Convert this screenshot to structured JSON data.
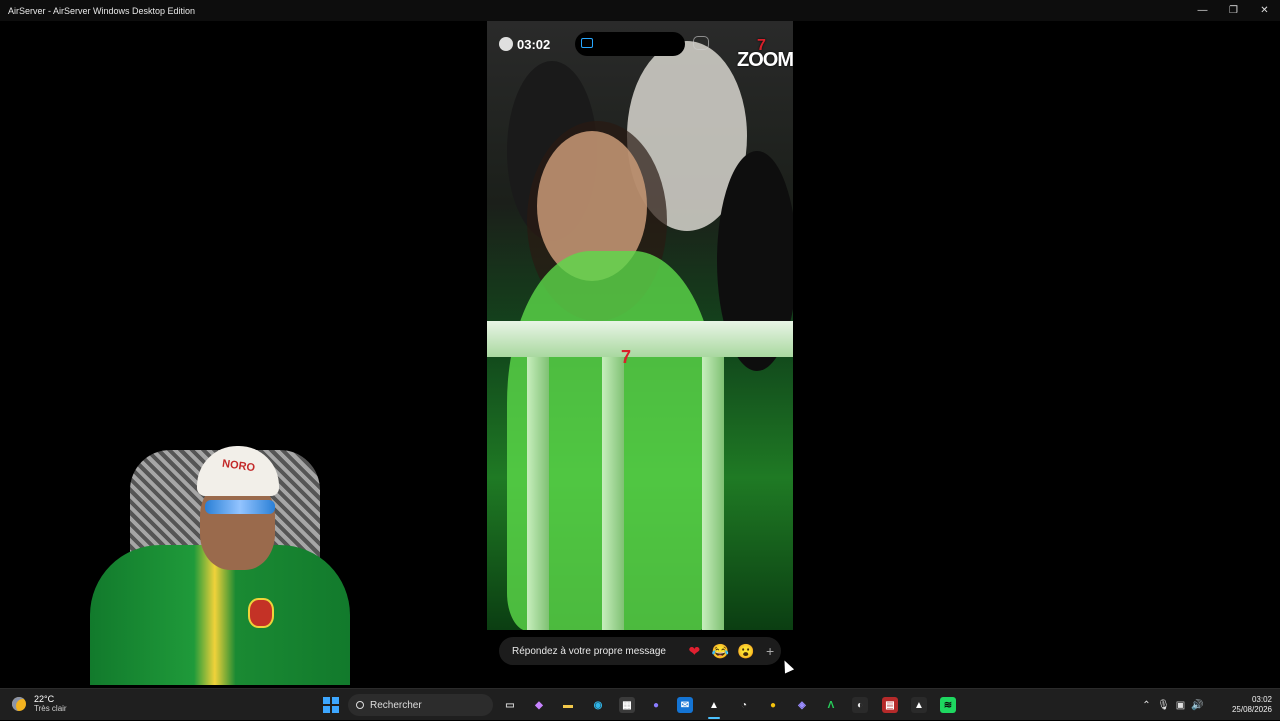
{
  "window": {
    "title": "AirServer - AirServer Windows Desktop Edition",
    "controls": {
      "minimize": "—",
      "restore": "❐",
      "close": "✕"
    }
  },
  "phone": {
    "status_time": "03:02",
    "watermark": "ZOOM",
    "watermark_seven": "7",
    "center_mark": "7"
  },
  "reply": {
    "placeholder": "Répondez à votre propre message",
    "reactions": [
      "❤",
      "😂",
      "😮"
    ],
    "plus": "+"
  },
  "webcam": {
    "cap_text": "NORO"
  },
  "taskbar": {
    "weather": {
      "temp": "22°C",
      "condition": "Très clair",
      "icon": "partly-sunny-icon"
    },
    "search": {
      "placeholder": "Rechercher"
    },
    "apps": [
      {
        "name": "task-view-icon",
        "glyph": "▭",
        "color": "#cfcfcf",
        "bg": "transparent"
      },
      {
        "name": "copilot-icon",
        "glyph": "◆",
        "color": "#c783ff",
        "bg": "transparent"
      },
      {
        "name": "file-explorer-icon",
        "glyph": "▬",
        "color": "#f2c84b",
        "bg": "transparent"
      },
      {
        "name": "edge-icon",
        "glyph": "◉",
        "color": "#2fb5e8",
        "bg": "transparent"
      },
      {
        "name": "store-icon",
        "glyph": "▦",
        "color": "#ffffff",
        "bg": "#3a3a3a"
      },
      {
        "name": "discord-icon",
        "glyph": "●",
        "color": "#8a7cff",
        "bg": "transparent"
      },
      {
        "name": "outlook-icon",
        "glyph": "✉",
        "color": "#ffffff",
        "bg": "#1474d4"
      },
      {
        "name": "airserver-icon",
        "glyph": "▲",
        "color": "#ffffff",
        "bg": "transparent",
        "active": true
      },
      {
        "name": "timer-icon",
        "glyph": "◔",
        "color": "#e6e6e6",
        "bg": "transparent"
      },
      {
        "name": "chrome-icon",
        "glyph": "●",
        "color": "#f4c20d",
        "bg": "transparent"
      },
      {
        "name": "game-controller-icon",
        "glyph": "◈",
        "color": "#9a8cff",
        "bg": "transparent"
      },
      {
        "name": "terminal-icon",
        "glyph": "Λ",
        "color": "#27d15b",
        "bg": "transparent"
      },
      {
        "name": "obs-icon",
        "glyph": "◐",
        "color": "#e6e6e6",
        "bg": "#2a2a2a"
      },
      {
        "name": "voicemeeter-icon",
        "glyph": "▤",
        "color": "#ffffff",
        "bg": "#b52a2a"
      },
      {
        "name": "capture-icon",
        "glyph": "▲",
        "color": "#ffffff",
        "bg": "#2a2a2a"
      },
      {
        "name": "spotify-icon",
        "glyph": "≋",
        "color": "#0c0c0c",
        "bg": "#1ed760"
      }
    ],
    "tray": {
      "chevron": "⌃",
      "mic": "🎙",
      "network": "▣",
      "volume": "🔊"
    },
    "clock": {
      "time": "03:02",
      "date": "25/08/2026"
    }
  }
}
